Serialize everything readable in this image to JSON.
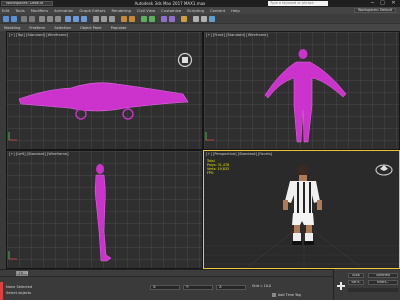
{
  "titlebar": {
    "workspace": "Workspaces: Default",
    "title": "Autodesk 3ds Max 2017   MAX1.max",
    "search_placeholder": "Type a keyword or phrase",
    "minimize": "─",
    "maximize": "□",
    "close": "✕"
  },
  "menubar": {
    "items": [
      "Edit",
      "Tools",
      "Modifiers",
      "Animation",
      "Graph Editors",
      "Rendering",
      "Civil View",
      "Customize",
      "Scripting",
      "Content",
      "Help"
    ],
    "workspace_right": "Workspaces: Default"
  },
  "ribbon": {
    "tabs": [
      "Modeling",
      "Freeform",
      "Selection",
      "Object Paint",
      "Populate"
    ]
  },
  "viewports": {
    "top": {
      "label": "[+] [Top] [Standard] [Wireframe]"
    },
    "front": {
      "label": "[+] [Front] [Standard] [Wireframe]"
    },
    "left": {
      "label": "[+] [Left] [Standard] [Wireframe]"
    },
    "perspective": {
      "label": "[+] [Perspective] [Standard] [Facets]",
      "stats_total": "Total",
      "stats_polys": "Polys:  31,478",
      "stats_verts": "Verts:  19,833",
      "stats_fps": "FPS:"
    }
  },
  "colors": {
    "model_wire": "#cc33cc",
    "active_border": "#e8c53a",
    "stats": "#e7e700"
  },
  "timeline": {
    "slider": "0 / 100"
  },
  "statusbar": {
    "line1": "None Selected",
    "line2": "Select objects",
    "x": "X:",
    "y": "Y:",
    "z": "Z:",
    "grid": "Grid = 10.0",
    "add_time_tag": "Add Time Tag"
  },
  "rpanel": {
    "auto": "Auto",
    "set_key": "Set K.",
    "selected": "Selected",
    "filters": "Filters..."
  }
}
